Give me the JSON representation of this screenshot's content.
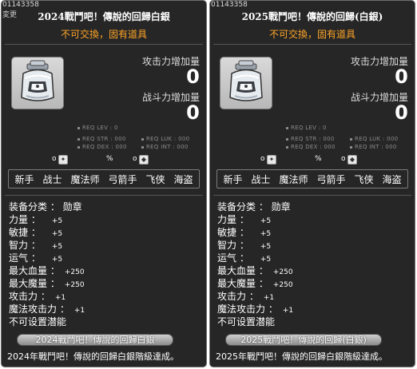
{
  "panels": [
    {
      "item_id": "01143358",
      "edit_label": "変更",
      "title": "2024戰鬥吧！傳說的回歸白銀",
      "trade": "不可交換，固有道具",
      "attack_label": "攻击力增加量",
      "attack_value": "0",
      "power_label": "战斗力增加量",
      "power_value": "0",
      "req_lev": "REQ LEV :    0",
      "req_str": "REQ STR : 000",
      "req_luk": "REQ LUK : 000",
      "req_dex": "REQ DEX : 000",
      "req_int": "REQ INT : 000",
      "mini_a": "o",
      "mini_b": "%",
      "mini_c": "o",
      "jobs": [
        "新手",
        "战士",
        "魔法师",
        "弓箭手",
        "飞侠",
        "海盗"
      ],
      "props": [
        {
          "label": "装备分类 ：  勋章",
          "value": ""
        },
        {
          "label": "力量 ：",
          "value": "+5"
        },
        {
          "label": "敏捷 ：",
          "value": "+5"
        },
        {
          "label": "智力 ：",
          "value": "+5"
        },
        {
          "label": "运气 ：",
          "value": "+5"
        },
        {
          "label": "最大血量 ：",
          "value": "+250"
        },
        {
          "label": "最大魔量 ：",
          "value": "+250"
        },
        {
          "label": "攻击力 ：",
          "value": "+1"
        },
        {
          "label": "魔法攻击力 ：",
          "value": "+1"
        },
        {
          "label": "不可设置潜能",
          "value": ""
        }
      ],
      "badge": "2024戰鬥吧！傳說的回歸白銀",
      "desc": "2024年戰鬥吧！傳說的回歸白銀階級達成。"
    },
    {
      "item_id": "01143358",
      "edit_label": "",
      "title": "2025戰鬥吧！傳說的回歸(白銀)",
      "trade": "不可交換，固有道具",
      "attack_label": "攻击力增加量",
      "attack_value": "0",
      "power_label": "战斗力增加量",
      "power_value": "0",
      "req_lev": "REQ LEV :    0",
      "req_str": "REQ STR : 000",
      "req_luk": "REQ LUK : 000",
      "req_dex": "REQ DEX : 000",
      "req_int": "REQ INT : 000",
      "mini_a": "o",
      "mini_b": "%",
      "mini_c": "o",
      "jobs": [
        "新手",
        "战士",
        "魔法师",
        "弓箭手",
        "飞侠",
        "海盗"
      ],
      "props": [
        {
          "label": "装备分类 ：  勋章",
          "value": ""
        },
        {
          "label": "力量 ：",
          "value": "+5"
        },
        {
          "label": "敏捷 ：",
          "value": "+5"
        },
        {
          "label": "智力 ：",
          "value": "+5"
        },
        {
          "label": "运气 ：",
          "value": "+5"
        },
        {
          "label": "最大血量 ：",
          "value": "+250"
        },
        {
          "label": "最大魔量 ：",
          "value": "+250"
        },
        {
          "label": "攻击力 ：",
          "value": "+1"
        },
        {
          "label": "魔法攻击力 ：",
          "value": "+1"
        },
        {
          "label": "不可设置潜能",
          "value": ""
        }
      ],
      "badge": "2025戰鬥吧！傳說的回歸(白銀)",
      "desc": "2025年戰鬥吧！傳說的回歸白銀階級達成。"
    }
  ],
  "colors": {
    "panel_bg": "#262626",
    "trade_text": "#ffa526",
    "req_text": "#8a8a8a"
  },
  "icons": {
    "item": "medal-bottle-icon",
    "mini_1": "wing-icon",
    "mini_2": "shield-icon"
  }
}
